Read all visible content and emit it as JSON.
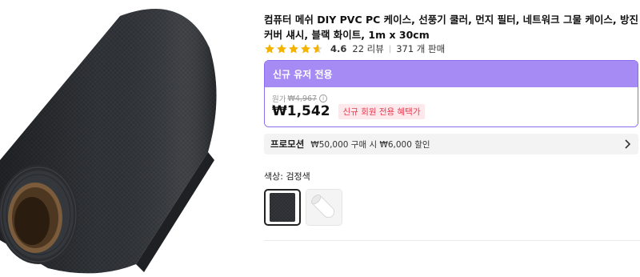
{
  "product": {
    "title": "컴퓨터 메쉬 DIY PVC PC 케이스, 선풍기 쿨러, 먼지 필터, 네트워크 그물 케이스, 방진 커버 섀시, 블랙 화이트, 1m x 30cm",
    "rating": "4.6",
    "reviews": "22 리뷰",
    "sold": "371 개 판매",
    "image_icon": "mesh-roll-image"
  },
  "promo": {
    "header": "신규 유저 전용",
    "original_label": "원가",
    "original_price": "₩4,967",
    "price": "₩1,542",
    "badge": "신규 회원 전용 혜택가"
  },
  "shipping": {
    "label": "프로모션",
    "text": "₩50,000 구매 시 ₩6,000 할인"
  },
  "color": {
    "label": "색상: 검정색",
    "options": [
      "black-mesh-swatch",
      "white-mesh-swatch"
    ],
    "selected": 0
  },
  "colors": {
    "accent": "#a78bf5",
    "accent_border": "#8b6cf0",
    "badge_red": "#e8394d",
    "star": "#f5b301"
  }
}
